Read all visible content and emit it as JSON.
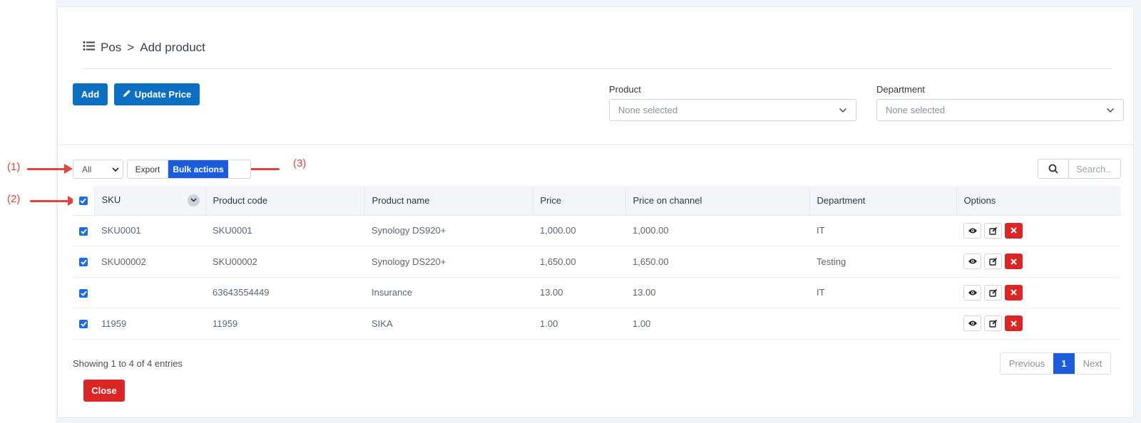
{
  "breadcrumb": {
    "root": "Pos",
    "separator": ">",
    "current": "Add product"
  },
  "toolbar": {
    "add_label": "Add",
    "update_price_label": "Update Price"
  },
  "filters": {
    "product": {
      "label": "Product",
      "value": "None selected"
    },
    "department": {
      "label": "Department",
      "value": "None selected"
    }
  },
  "table_controls": {
    "length_value": "All",
    "export_label": "Export",
    "bulk_actions_label": "Bulk actions",
    "search_placeholder": "Search.."
  },
  "annotations": {
    "one": "(1)",
    "two": "(2)",
    "three": "(3)"
  },
  "table": {
    "columns": [
      "SKU",
      "Product code",
      "Product name",
      "Price",
      "Price on channel",
      "Department",
      "Options"
    ],
    "rows": [
      {
        "sku": "SKU0001",
        "code": "SKU0001",
        "name": "Synology DS920+",
        "price": "1,000.00",
        "channel_price": "1,000.00",
        "department": "IT",
        "checked": true
      },
      {
        "sku": "SKU00002",
        "code": "SKU00002",
        "name": "Synology DS220+",
        "price": "1,650.00",
        "channel_price": "1,650.00",
        "department": "Testing",
        "checked": true
      },
      {
        "sku": "",
        "code": "63643554449",
        "name": "Insurance",
        "price": "13.00",
        "channel_price": "13.00",
        "department": "IT",
        "checked": true
      },
      {
        "sku": "11959",
        "code": "11959",
        "name": "SIKA",
        "price": "1.00",
        "channel_price": "1.00",
        "department": "",
        "checked": true
      }
    ]
  },
  "footer": {
    "info": "Showing 1 to 4 of 4 entries",
    "prev_label": "Previous",
    "current_page": "1",
    "next_label": "Next",
    "close_label": "Close"
  },
  "colors": {
    "primary": "#0d6fc2",
    "accent": "#1b5bdc",
    "danger": "#dc2626",
    "annotation": "#e0443b"
  },
  "icons": {
    "breadcrumb": "list-icon",
    "update_price": "pencil-icon",
    "search": "search-icon",
    "view": "eye-icon",
    "edit": "edit-icon",
    "delete": "close-icon",
    "sort": "chevron-down-icon"
  }
}
